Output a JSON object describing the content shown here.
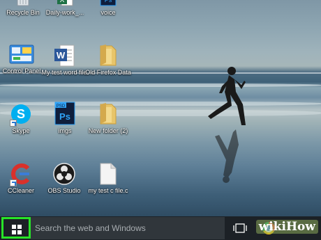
{
  "desktop": {
    "icons": [
      {
        "label": "Recycle Bin",
        "icon": "recycle-bin-icon"
      },
      {
        "label": "Daily-work_...",
        "icon": "excel-file-icon"
      },
      {
        "label": "voice",
        "icon": "photoshop-file-icon"
      },
      {
        "label": "Control Panel",
        "icon": "control-panel-icon"
      },
      {
        "label": "My test word file",
        "icon": "word-file-icon"
      },
      {
        "label": "Old Firefox Data",
        "icon": "folder-icon"
      },
      {
        "label": "Skype",
        "icon": "skype-icon"
      },
      {
        "label": "imgs",
        "icon": "photoshop-file-icon"
      },
      {
        "label": "New folder (2)",
        "icon": "folder-icon"
      },
      {
        "label": "CCleaner",
        "icon": "ccleaner-icon"
      },
      {
        "label": "OBS Studio",
        "icon": "obs-studio-icon"
      },
      {
        "label": "my test c file.c",
        "icon": "blank-file-icon"
      }
    ]
  },
  "taskbar": {
    "search_placeholder": "Search the web and Windows",
    "start_icon": "windows-logo-icon",
    "task_view_icon": "task-view-icon",
    "pinned": [
      {
        "icon": "chrome-icon"
      }
    ],
    "watermark": "wikiHow"
  },
  "colors": {
    "start_highlight": "#28e528",
    "taskbar_bg": "#1c2126",
    "search_bg": "#30363b"
  }
}
